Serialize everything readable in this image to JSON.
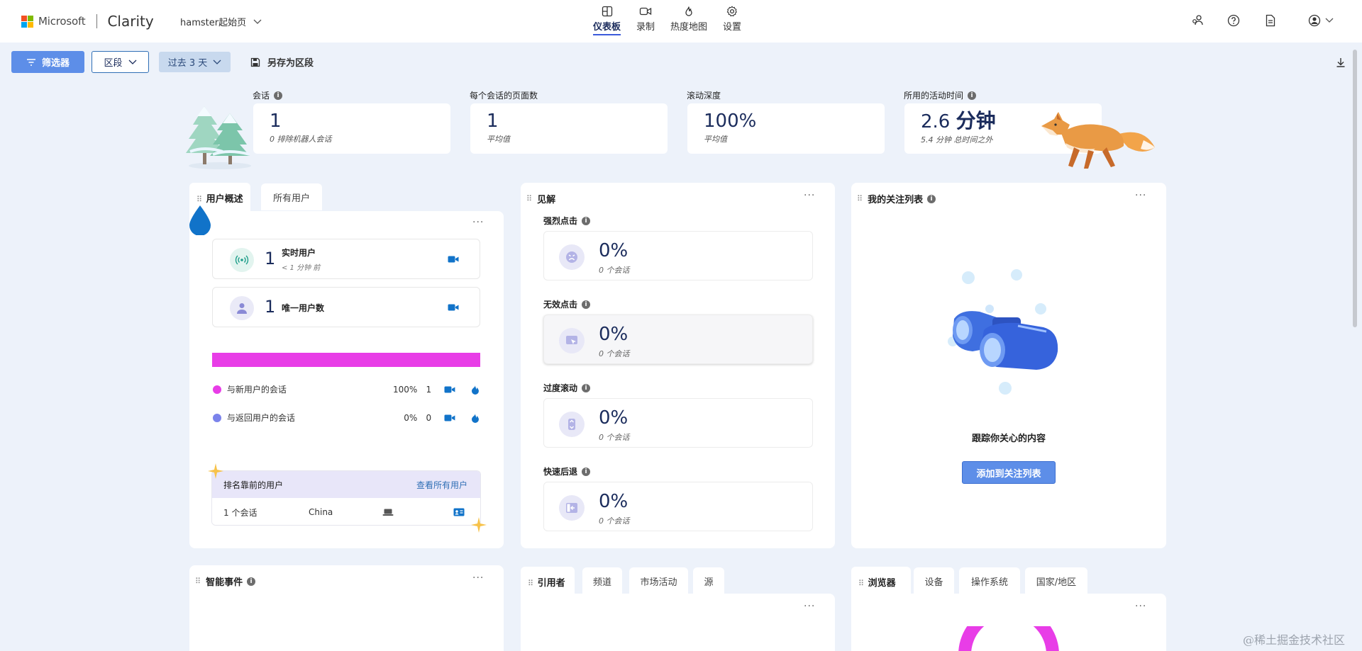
{
  "header": {
    "brand_microsoft": "Microsoft",
    "brand_product": "Clarity",
    "project_name": "hamster起始页",
    "nav": [
      {
        "label": "仪表板",
        "icon": "dashboard-icon",
        "active": true
      },
      {
        "label": "录制",
        "icon": "video-camera-icon",
        "active": false
      },
      {
        "label": "热度地图",
        "icon": "flame-icon",
        "active": false
      },
      {
        "label": "设置",
        "icon": "gear-icon",
        "active": false
      }
    ],
    "right_icons": [
      "share-users-icon",
      "help-icon",
      "document-icon",
      "account-icon"
    ]
  },
  "toolbar": {
    "filter_label": "筛选器",
    "segment_label": "区段",
    "date_range_label": "过去 3 天",
    "save_segment_label": "另存为区段"
  },
  "metrics": [
    {
      "label": "会话",
      "info": true,
      "value": "1",
      "sub": "0 排除机器人会话"
    },
    {
      "label": "每个会话的页面数",
      "info": false,
      "value": "1",
      "sub": "平均值"
    },
    {
      "label": "滚动深度",
      "info": false,
      "value": "100%",
      "sub": "平均值"
    },
    {
      "label": "所用的活动时间",
      "info": true,
      "value_number": "2.6",
      "value_unit": "分钟",
      "sub": "5.4 分钟 总时间之外"
    }
  ],
  "user_overview": {
    "tab_active": "用户概述",
    "tab_other": "所有用户",
    "live_users": {
      "value": "1",
      "label": "实时用户",
      "sub": "< 1 分钟 前"
    },
    "unique_users": {
      "value": "1",
      "label": "唯一用户数"
    },
    "new_user_share": 1.0,
    "legend": [
      {
        "label": "与新用户的会话",
        "percent": "100%",
        "count": "1",
        "color": "#e83de7"
      },
      {
        "label": "与返回用户的会话",
        "percent": "0%",
        "count": "0",
        "color": "#7b83eb"
      }
    ],
    "top_users_title": "排名靠前的用户",
    "top_users_link": "查看所有用户",
    "top_user_row": {
      "sessions": "1 个会话",
      "country": "China"
    }
  },
  "insights": {
    "title": "见解",
    "items": [
      {
        "label": "强烈点击",
        "value": "0%",
        "sub": "0 个会话",
        "icon": "angry-face-icon"
      },
      {
        "label": "无效点击",
        "value": "0%",
        "sub": "0 个会话",
        "icon": "cursor-click-icon"
      },
      {
        "label": "过度滚动",
        "value": "0%",
        "sub": "0 个会话",
        "icon": "scroll-icon"
      },
      {
        "label": "快速后退",
        "value": "0%",
        "sub": "0 个会话",
        "icon": "back-arrow-icon"
      }
    ]
  },
  "watchlist": {
    "title": "我的关注列表",
    "empty_text": "跟踪你关心的内容",
    "add_button": "添加到关注列表"
  },
  "bottom": {
    "smart_events_title": "智能事件",
    "referrer_tabs": [
      "引用者",
      "频道",
      "市场活动",
      "源"
    ],
    "browser_tabs": [
      "浏览器",
      "设备",
      "操作系统",
      "国家/地区"
    ]
  },
  "watermark": "@稀土掘金技术社区",
  "colors": {
    "accent": "#5d8ee8",
    "navy_text": "#1b2c5c",
    "new_users": "#e83de7",
    "returning_users": "#7b83eb",
    "background": "#edf2fa"
  }
}
